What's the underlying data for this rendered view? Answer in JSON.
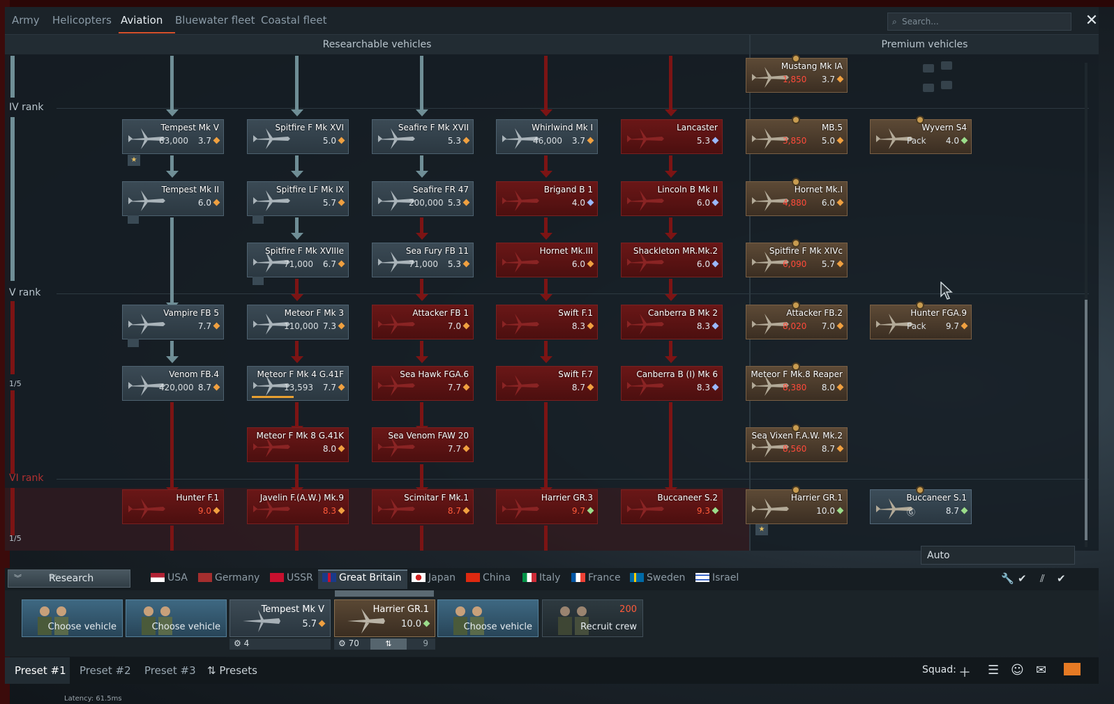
{
  "top_tabs": [
    "Army",
    "Helicopters",
    "Aviation",
    "Bluewater fleet",
    "Coastal fleet"
  ],
  "active_tab": "Aviation",
  "search_placeholder": "Search...",
  "sections": {
    "researchable": "Researchable vehicles",
    "premium": "Premium vehicles"
  },
  "ranks": {
    "iv": "IV rank",
    "v": "V rank",
    "vi": "VI rank",
    "v_progress": "1/5",
    "vi_progress": "1/5"
  },
  "research_cards": [
    {
      "name": "Tempest Mk V",
      "cost": "63,000",
      "br": "3.7",
      "mark": "orange",
      "style": "gray"
    },
    {
      "name": "Spitfire F Mk XVI",
      "cost": "",
      "br": "5.0",
      "mark": "orange",
      "style": "gray"
    },
    {
      "name": "Seafire F Mk XVII",
      "cost": "",
      "br": "5.3",
      "mark": "orange",
      "style": "gray"
    },
    {
      "name": "Whirlwind Mk I",
      "cost": "46,000",
      "br": "3.7",
      "mark": "orange",
      "style": "gray"
    },
    {
      "name": "Lancaster",
      "cost": "",
      "br": "5.3",
      "mark": "blue",
      "style": "red"
    },
    {
      "name": "Tempest Mk II",
      "cost": "",
      "br": "6.0",
      "mark": "orange",
      "style": "gray"
    },
    {
      "name": "Spitfire LF Mk IX",
      "cost": "",
      "br": "5.7",
      "mark": "orange",
      "style": "gray"
    },
    {
      "name": "Seafire FR 47",
      "cost": "200,000",
      "br": "5.3",
      "mark": "orange",
      "style": "gray"
    },
    {
      "name": "Brigand B 1",
      "cost": "",
      "br": "4.0",
      "mark": "blue",
      "style": "red"
    },
    {
      "name": "Lincoln B Mk II",
      "cost": "",
      "br": "6.0",
      "mark": "blue",
      "style": "red"
    },
    {
      "name": "Spitfire F Mk XVIIIe",
      "cost": "71,000",
      "br": "6.7",
      "mark": "orange",
      "style": "gray"
    },
    {
      "name": "Sea Fury FB 11",
      "cost": "71,000",
      "br": "5.3",
      "mark": "orange",
      "style": "gray"
    },
    {
      "name": "Hornet Mk.III",
      "cost": "",
      "br": "6.0",
      "mark": "orange",
      "style": "red"
    },
    {
      "name": "Shackleton MR.Mk.2",
      "cost": "",
      "br": "6.0",
      "mark": "blue",
      "style": "red"
    },
    {
      "name": "Vampire FB 5",
      "cost": "",
      "br": "7.7",
      "mark": "orange",
      "style": "gray"
    },
    {
      "name": "Meteor F Mk 3",
      "cost": "110,000",
      "br": "7.3",
      "mark": "orange",
      "style": "gray"
    },
    {
      "name": "Attacker FB 1",
      "cost": "",
      "br": "7.0",
      "mark": "orange",
      "style": "red"
    },
    {
      "name": "Swift F.1",
      "cost": "",
      "br": "8.3",
      "mark": "orange",
      "style": "red"
    },
    {
      "name": "Canberra B Mk 2",
      "cost": "",
      "br": "8.3",
      "mark": "blue",
      "style": "red"
    },
    {
      "name": "Venom FB.4",
      "cost": "420,000",
      "br": "8.7",
      "mark": "orange",
      "style": "gray"
    },
    {
      "name": "Meteor F Mk 4 G.41F",
      "cost": "13,593",
      "br": "7.7",
      "mark": "orange",
      "style": "gray",
      "progress": 0.45
    },
    {
      "name": "Sea Hawk FGA.6",
      "cost": "",
      "br": "7.7",
      "mark": "orange",
      "style": "red"
    },
    {
      "name": "Swift F.7",
      "cost": "",
      "br": "8.7",
      "mark": "orange",
      "style": "red"
    },
    {
      "name": "Canberra B (I) Mk 6",
      "cost": "",
      "br": "8.3",
      "mark": "blue",
      "style": "red"
    },
    {
      "name": "Meteor F Mk 8 G.41K",
      "cost": "",
      "br": "8.0",
      "mark": "orange",
      "style": "red"
    },
    {
      "name": "Sea Venom FAW 20",
      "cost": "",
      "br": "7.7",
      "mark": "orange",
      "style": "red"
    },
    {
      "name": "Hunter F.1",
      "cost": "",
      "br": "9.0",
      "mark": "orange",
      "style": "red"
    },
    {
      "name": "Javelin F.(A.W.) Mk.9",
      "cost": "",
      "br": "8.3",
      "mark": "orange",
      "style": "red"
    },
    {
      "name": "Scimitar F Mk.1",
      "cost": "",
      "br": "8.7",
      "mark": "orange",
      "style": "red"
    },
    {
      "name": "Harrier GR.3",
      "cost": "",
      "br": "9.7",
      "mark": "green",
      "style": "red"
    },
    {
      "name": "Buccaneer S.2",
      "cost": "",
      "br": "9.3",
      "mark": "green",
      "style": "red"
    }
  ],
  "premium_cards": [
    {
      "name": "Mustang Mk IA",
      "cost": "1,850",
      "br": "3.7",
      "mark": "orange",
      "style": "prem"
    },
    {
      "name": "MB.5",
      "cost": "3,850",
      "br": "5.0",
      "mark": "orange",
      "style": "prem"
    },
    {
      "name": "Wyvern S4",
      "cost": "Pack",
      "br": "4.0",
      "mark": "green",
      "style": "prem"
    },
    {
      "name": "Hornet Mk.I",
      "cost": "4,880",
      "br": "6.0",
      "mark": "orange",
      "style": "prem"
    },
    {
      "name": "Spitfire F Mk XIVc",
      "cost": "6,090",
      "br": "5.7",
      "mark": "orange",
      "style": "prem"
    },
    {
      "name": "Attacker FB.2",
      "cost": "8,020",
      "br": "7.0",
      "mark": "orange",
      "style": "prem"
    },
    {
      "name": "Hunter FGA.9",
      "cost": "Pack",
      "br": "9.7",
      "mark": "orange",
      "style": "prem"
    },
    {
      "name": "Meteor F Mk.8 Reaper",
      "cost": "8,380",
      "br": "8.0",
      "mark": "orange",
      "style": "prem"
    },
    {
      "name": "Sea Vixen F.A.W. Mk.2",
      "cost": "8,560",
      "br": "8.7",
      "mark": "orange",
      "style": "prem"
    },
    {
      "name": "Harrier GR.1",
      "cost": "",
      "br": "10.0",
      "mark": "green",
      "style": "prem"
    },
    {
      "name": "Buccaneer S.1",
      "cost": "Ⓖ",
      "br": "8.7",
      "mark": "green",
      "style": "prem-blue"
    }
  ],
  "auto_select": "Auto",
  "research_button": "Research",
  "countries": [
    "USA",
    "Germany",
    "USSR",
    "Great Britain",
    "Japan",
    "China",
    "Italy",
    "France",
    "Sweden",
    "Israel"
  ],
  "active_country": "Great Britain",
  "crew_slots": [
    {
      "type": "empty",
      "label": "Choose vehicle"
    },
    {
      "type": "empty",
      "label": "Choose vehicle"
    },
    {
      "type": "filled",
      "name": "Tempest Mk V",
      "br": "5.7",
      "crew_level": "4"
    },
    {
      "type": "prem",
      "name": "Harrier GR.1",
      "br": "10.0",
      "crew_level": "70",
      "extra": "9"
    },
    {
      "type": "empty",
      "label": "Choose vehicle"
    },
    {
      "type": "recruit",
      "label": "Recruit crew",
      "cost": "200"
    }
  ],
  "presets": [
    "Preset #1",
    "Preset #2",
    "Preset #3"
  ],
  "presets_menu": "Presets",
  "squad_label": "Squad:",
  "latency": "Latency: 61.5ms",
  "colors": {
    "orange": "#f0a040",
    "blue": "#9ab8ff",
    "green": "#9bdc8a",
    "accent": "#d6502b"
  }
}
